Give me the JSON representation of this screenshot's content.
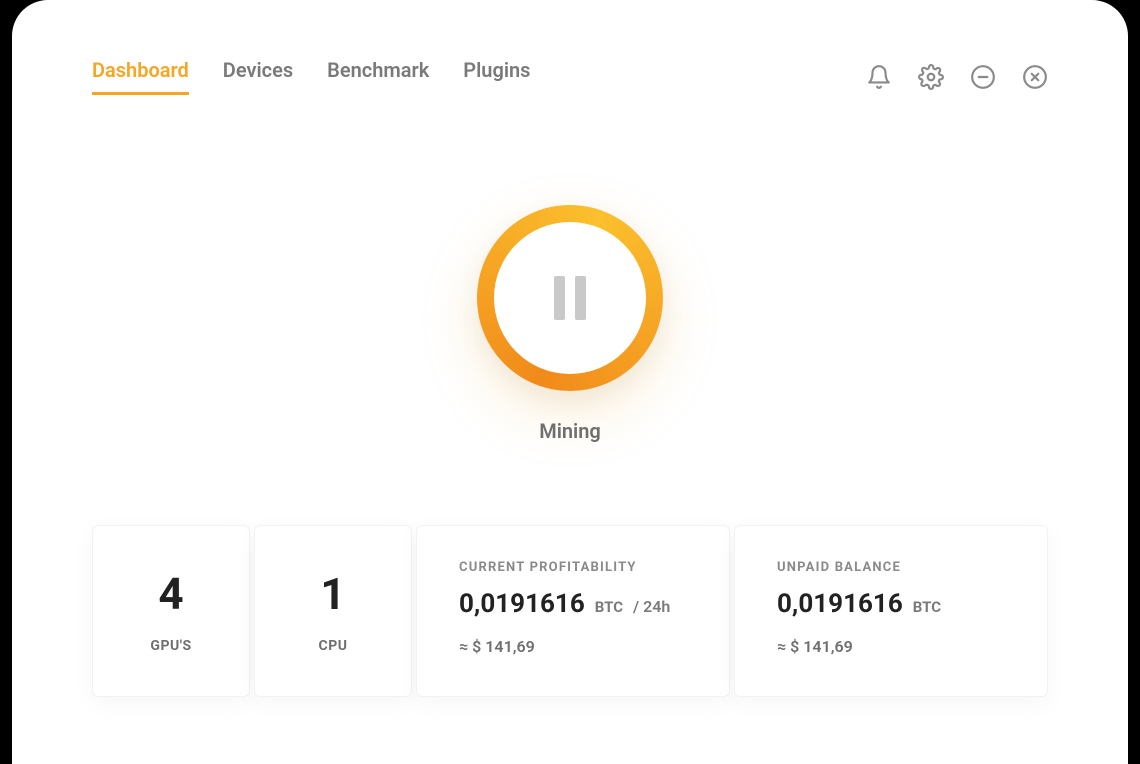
{
  "tabs": {
    "dashboard": "Dashboard",
    "devices": "Devices",
    "benchmark": "Benchmark",
    "plugins": "Plugins"
  },
  "mining": {
    "status_label": "Mining"
  },
  "stats": {
    "gpus": {
      "count": "4",
      "label": "GPU'S"
    },
    "cpu": {
      "count": "1",
      "label": "CPU"
    },
    "profitability": {
      "label": "CURRENT PROFITABILITY",
      "value": "0,0191616",
      "unit": "BTC",
      "per": "/ 24h",
      "approx": "≈ $ 141,69"
    },
    "balance": {
      "label": "UNPAID BALANCE",
      "value": "0,0191616",
      "unit": "BTC",
      "approx": "≈ $ 141,69"
    }
  }
}
